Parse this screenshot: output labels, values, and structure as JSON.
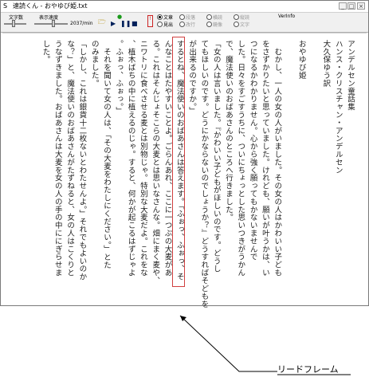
{
  "window": {
    "title": "速読くん - おやゆび姫.txt"
  },
  "titlebar_buttons": {
    "minimize": "_",
    "maximize": "□",
    "close": "×"
  },
  "toolbar": {
    "char_count_label": "文字数",
    "display_speed_label": "表示速度",
    "speed_value": "2037/min",
    "stop_marker": "!",
    "mode_radios": [
      {
        "label": "文章",
        "selected": true
      },
      {
        "label": "見出",
        "selected": false
      },
      {
        "label": "段落",
        "selected": false
      },
      {
        "label": "改行",
        "selected": false
      },
      {
        "label": "横読",
        "selected": false
      },
      {
        "label": "鏡像",
        "selected": false
      },
      {
        "label": "縦読",
        "selected": false
      },
      {
        "label": "文字",
        "selected": false
      }
    ],
    "verinfo_label": "VerInfo"
  },
  "text_columns": [
    "アンデルセン童話集",
    "ハンス・クリスチャン・アンデルセン",
    "大久保ゆう訳",
    "",
    "おやゆび姫",
    "",
    "　むかし、一人の女の人がいました。その女の人はかわいい子ども",
    "をさずかりたいと思っていました。けれども、願いが叶うかは、い",
    "つになるかわかりません。心から強く願ってもかないませんで",
    "した。日々をすごすうちに、ついにちょっとした思いつきがうかん",
    "で、魔法使いのおばあさんのところへ行きました。",
    "「女の人は言いました。『かわいい子どもがほしいのです。どうし",
    "てもほしいのです。どうにかならないのでしょうか？』どうすればそどもを",
    "が出来るのですか。」",
    "するとね、魔法使いのおばあさんは答えます。「ふぉっ、ふぉっ、そ",
    "んなことはたやすいことよ。ごらんあれ、ここに一つぶの大麦があ",
    "る。これはそんじょそこらの大麦とは思いなさんな。畑にまく麦や、",
    "ニワトリに食べさせる麦とは別物じゃ。特別な大麦だよ。これをな",
    "、植木ばちの中に植えるのじゃ。すると、何かが起こるはずじゃよ",
    "。ふぉっ、ふぉっ。」",
    "　それを聞いて女の人は、「その大麦をわたしにください。」とた",
    "のみました。",
    "「しかし、これは銀貨十二枚ないとわたせんよ。」それでもよいのか",
    "な？」と、魔法使いのおばあさんがたずねると、女の人はこくりと",
    "うなずきました。おばあさんは大麦を女の人の手の中ににぎらせま",
    "した。"
  ],
  "annotation": {
    "label": "リードフレーム"
  }
}
